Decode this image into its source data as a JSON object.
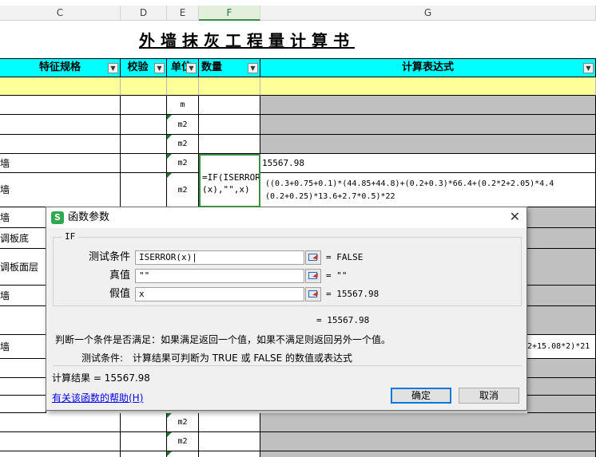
{
  "sheet": {
    "columns": [
      {
        "id": "C",
        "label": "C"
      },
      {
        "id": "D",
        "label": "D"
      },
      {
        "id": "E",
        "label": "E"
      },
      {
        "id": "F",
        "label": "F"
      },
      {
        "id": "G",
        "label": "G"
      }
    ],
    "title": "外墙抹灰工程量计算书",
    "headers": {
      "spec": "特征规格",
      "check": "校验",
      "unit": "单位",
      "qty": "数量",
      "expr": "计算表达式"
    },
    "dropdown_glyph": "▼",
    "rows": [
      {
        "label": "",
        "unit": "m"
      },
      {
        "label": "",
        "unit": "m2"
      },
      {
        "label": "",
        "unit": "m2"
      },
      {
        "label": "墙",
        "unit": "m2",
        "value": "15567.98"
      },
      {
        "label": "墙",
        "unit": "m2",
        "formula_line1": "=IF(ISERROR",
        "formula_line2": "(x),\"\",x)",
        "expr_line1": "((0.3+0.75+0.1)*(44.85+44.8)+(0.2+0.3)*66.4+(0.2*2+2.05)*4.4",
        "expr_line2": "(0.2+0.25)*13.6+2.7*0.5)*22"
      },
      {
        "label": "墙"
      },
      {
        "label": "调板底"
      },
      {
        "label": "调板面层"
      },
      {
        "label": "墙"
      },
      {
        "label": "墙",
        "expr_tail": "2+15.08*2)*21"
      }
    ],
    "bottom_units": [
      "m2",
      "m2"
    ]
  },
  "dialog": {
    "title": "函数参数",
    "logo": "S",
    "close": "✕",
    "function_name": "IF",
    "params": [
      {
        "label": "测试条件",
        "value": "ISERROR(x)|",
        "result": "= FALSE"
      },
      {
        "label": "真值",
        "value": "\"\"",
        "result": "= \"\""
      },
      {
        "label": "假值",
        "value": "x",
        "result": "= 15567.98"
      }
    ],
    "overall_result": "= 15567.98",
    "description": "判断一个条件是否满足：如果满足返回一个值，如果不满足则返回另外一个值。",
    "param_help_label": "测试条件:",
    "param_help_text": "计算结果可判断为 TRUE 或 FALSE 的数值或表达式",
    "calc_result": "计算结果 = 15567.98",
    "help_link": "有关该函数的帮助(H)",
    "ok": "确定",
    "cancel": "取消"
  }
}
